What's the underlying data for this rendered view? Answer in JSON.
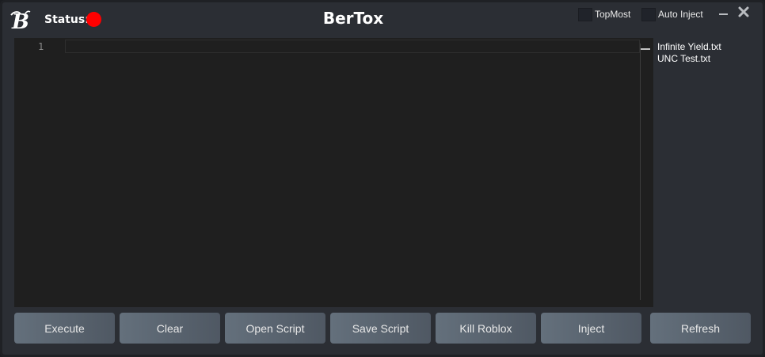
{
  "titlebar": {
    "status_label": "Status:",
    "status_color": "#ff0000",
    "app_title": "BerTox",
    "logo_icon": "bertox-b-logo-icon",
    "topmost_label": "TopMost",
    "topmost_checked": false,
    "autoinject_label": "Auto Inject",
    "autoinject_checked": false,
    "minimize_icon": "minimize-icon",
    "close_icon": "close-icon"
  },
  "editor": {
    "line_numbers": [
      "1"
    ],
    "content": ""
  },
  "script_list": {
    "items": [
      "Infinite Yield.txt",
      "UNC Test.txt"
    ]
  },
  "buttons": {
    "execute": "Execute",
    "clear": "Clear",
    "open_script": "Open Script",
    "save_script": "Save Script",
    "kill_roblox": "Kill Roblox",
    "inject": "Inject",
    "refresh": "Refresh"
  },
  "colors": {
    "window_bg": "#2b2e34",
    "editor_bg": "#1f1f1f",
    "button_gradient_start": "#64707c",
    "button_gradient_end": "#4f5863",
    "status_red": "#ff0000"
  }
}
